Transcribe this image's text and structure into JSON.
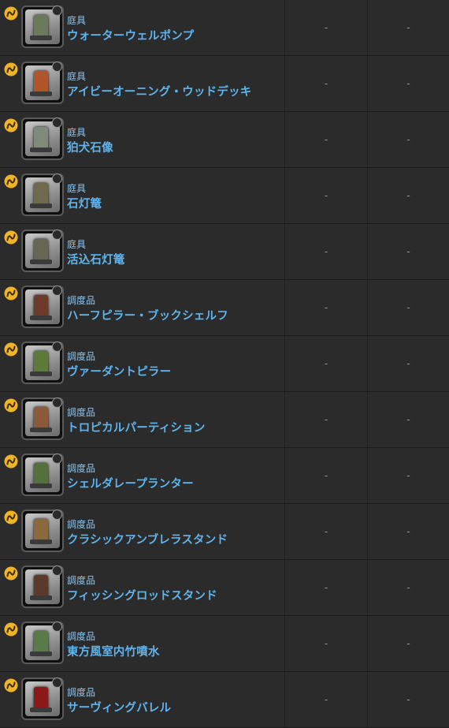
{
  "rows": [
    {
      "category": "庭具",
      "name": "ウォーターウェルポンプ",
      "col_a": "-",
      "col_b": "-",
      "icon": "water-well-pump",
      "tint": "#6b7a5a"
    },
    {
      "category": "庭具",
      "name": "アイビーオーニング・ウッドデッキ",
      "col_a": "-",
      "col_b": "-",
      "icon": "ivy-awning-wood-deck",
      "tint": "#b0552c"
    },
    {
      "category": "庭具",
      "name": "狛犬石像",
      "col_a": "-",
      "col_b": "-",
      "icon": "komainu-statue",
      "tint": "#7f8a7a"
    },
    {
      "category": "庭具",
      "name": "石灯篭",
      "col_a": "-",
      "col_b": "-",
      "icon": "stone-lantern",
      "tint": "#6f6a4e"
    },
    {
      "category": "庭具",
      "name": "活込石灯篭",
      "col_a": "-",
      "col_b": "-",
      "icon": "garden-stone-lantern",
      "tint": "#666654"
    },
    {
      "category": "調度品",
      "name": "ハーフピラー・ブックシェルフ",
      "col_a": "-",
      "col_b": "-",
      "icon": "half-pillar-bookshelf",
      "tint": "#6b3a2a"
    },
    {
      "category": "調度品",
      "name": "ヴァーダントピラー",
      "col_a": "-",
      "col_b": "-",
      "icon": "verdant-pillar",
      "tint": "#5d7a3a"
    },
    {
      "category": "調度品",
      "name": "トロピカルパーティション",
      "col_a": "-",
      "col_b": "-",
      "icon": "tropical-partition",
      "tint": "#8a5a3a"
    },
    {
      "category": "調度品",
      "name": "シェルダレープランター",
      "col_a": "-",
      "col_b": "-",
      "icon": "shelldare-planter",
      "tint": "#55703a"
    },
    {
      "category": "調度品",
      "name": "クラシックアンブレラスタンド",
      "col_a": "-",
      "col_b": "-",
      "icon": "classic-umbrella-stand",
      "tint": "#8a6a3a"
    },
    {
      "category": "調度品",
      "name": "フィッシングロッドスタンド",
      "col_a": "-",
      "col_b": "-",
      "icon": "fishing-rod-stand",
      "tint": "#5a3a2a"
    },
    {
      "category": "調度品",
      "name": "東方風室内竹噴水",
      "col_a": "-",
      "col_b": "-",
      "icon": "eastern-bamboo-fountain",
      "tint": "#5a7a4a"
    },
    {
      "category": "調度品",
      "name": "サーヴィングバレル",
      "col_a": "-",
      "col_b": "-",
      "icon": "serving-barrel",
      "tint": "#8a1a1a"
    }
  ],
  "colors": {
    "background": "#2b2b2b",
    "category_text": "#8fc4ea",
    "name_text": "#5fb4ee",
    "gil_icon": "#f0b429"
  }
}
